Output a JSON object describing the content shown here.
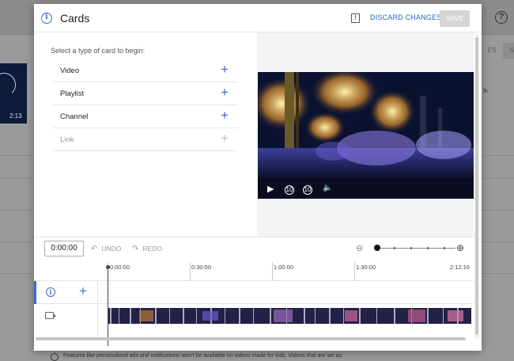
{
  "background": {
    "help_glyph": "?",
    "thumb_time": "2:13",
    "right_btn_1": "ES",
    "right_btn_2": "SA",
    "right_link": "lk",
    "bottom_text": "Features like personalized ads and notifications won't be available on videos made for kids. Videos that are set as"
  },
  "modal": {
    "title": "Cards",
    "info_glyph": "i",
    "feedback_glyph": "!",
    "discard_label": "DISCARD CHANGES",
    "save_label": "SAVE"
  },
  "card_picker": {
    "prompt": "Select a type of card to begin:",
    "plus_glyph": "+",
    "types": [
      {
        "label": "Video",
        "enabled": true
      },
      {
        "label": "Playlist",
        "enabled": true
      },
      {
        "label": "Channel",
        "enabled": true
      },
      {
        "label": "Link",
        "enabled": false
      }
    ]
  },
  "player": {
    "play_glyph": "▶",
    "rewind_glyph": "10",
    "forward_glyph": "10",
    "volume_glyph": "🔈"
  },
  "timeline": {
    "current_time": "0:00:00",
    "undo_label": "UNDO",
    "undo_glyph": "↶",
    "redo_label": "REDO",
    "redo_glyph": "↷",
    "zoom_out_glyph": "⊖",
    "zoom_in_glyph": "⊕",
    "ticks": [
      "0:00:00",
      "0:30:00",
      "1:00:00",
      "1:30:00",
      "2:12:16"
    ]
  },
  "tracks": {
    "info_glyph": "i",
    "add_glyph": "+"
  },
  "colors": {
    "accent": "#3a6bc9",
    "link": "#1f63c9",
    "save_disabled": "#d6d6d6"
  }
}
